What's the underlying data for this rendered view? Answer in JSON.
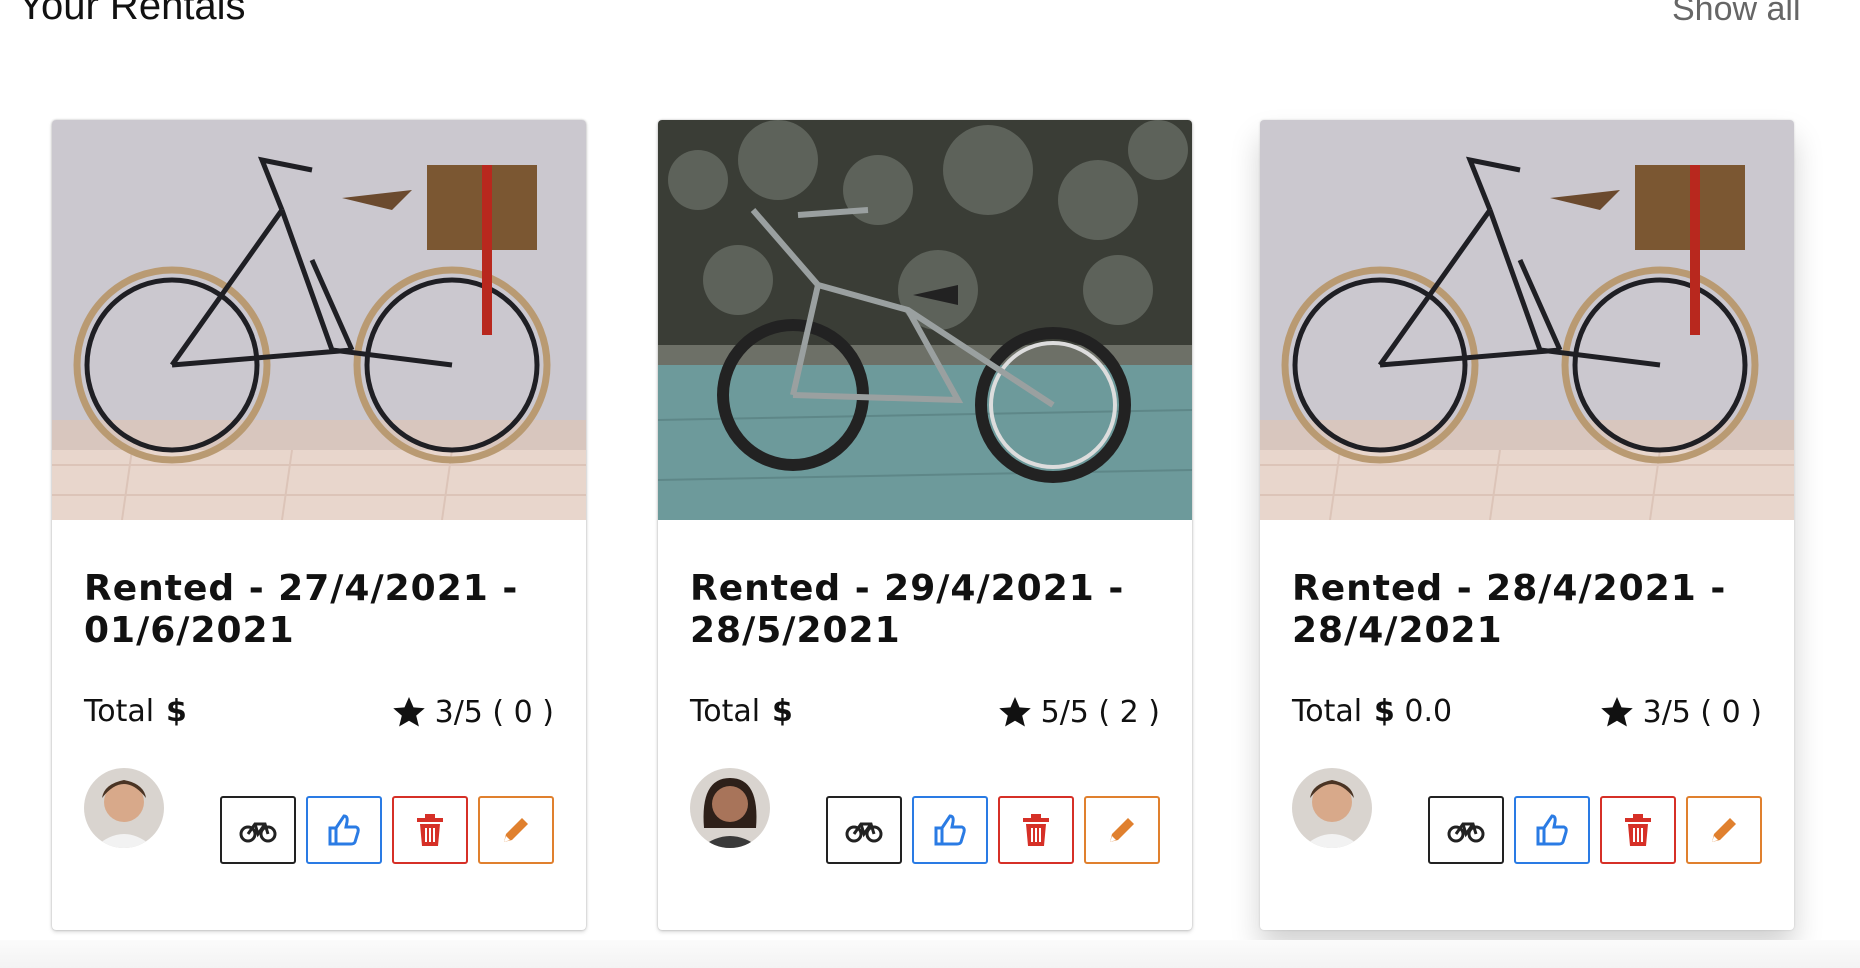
{
  "header": {
    "title": "Your Rentals",
    "show_all": "Show all"
  },
  "rentals": [
    {
      "title": "Rented - 27/4/2021 - 01/6/2021",
      "total_label": "Total",
      "currency": "$",
      "total_value": "",
      "rating": "3/5 ( 0 )"
    },
    {
      "title": "Rented - 29/4/2021 - 28/5/2021",
      "total_label": "Total",
      "currency": "$",
      "total_value": "",
      "rating": "5/5 ( 2 )"
    },
    {
      "title": "Rented - 28/4/2021 - 28/4/2021",
      "total_label": "Total",
      "currency": "$",
      "total_value": "0.0",
      "rating": "3/5 ( 0 )"
    }
  ],
  "icons": {
    "rating": "star-icon",
    "view": "bicycle-icon",
    "like": "thumbs-up-icon",
    "delete": "trash-icon",
    "edit": "pencil-icon"
  },
  "colors": {
    "like": "#2a7be4",
    "delete": "#d63027",
    "edit": "#e0802e"
  }
}
